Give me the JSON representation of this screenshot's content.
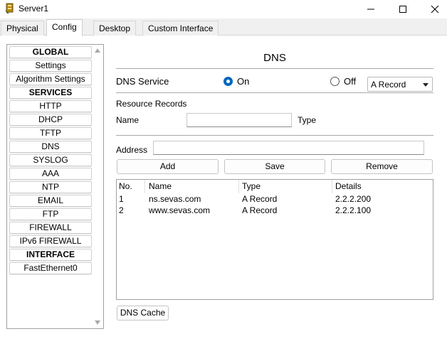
{
  "window": {
    "title": "Server1",
    "icons": [
      "app-icon",
      "minimize-icon",
      "maximize-icon",
      "close-icon"
    ]
  },
  "tabs": [
    {
      "label": "Physical"
    },
    {
      "label": "Config"
    },
    {
      "label": "Desktop"
    },
    {
      "label": "Custom Interface"
    }
  ],
  "active_tab": "Config",
  "sidebar": {
    "items": [
      {
        "label": "GLOBAL",
        "kind": "header"
      },
      {
        "label": "Settings",
        "kind": "item"
      },
      {
        "label": "Algorithm Settings",
        "kind": "item"
      },
      {
        "label": "SERVICES",
        "kind": "header"
      },
      {
        "label": "HTTP",
        "kind": "item"
      },
      {
        "label": "DHCP",
        "kind": "item"
      },
      {
        "label": "TFTP",
        "kind": "item"
      },
      {
        "label": "DNS",
        "kind": "item"
      },
      {
        "label": "SYSLOG",
        "kind": "item"
      },
      {
        "label": "AAA",
        "kind": "item"
      },
      {
        "label": "NTP",
        "kind": "item"
      },
      {
        "label": "EMAIL",
        "kind": "item"
      },
      {
        "label": "FTP",
        "kind": "item"
      },
      {
        "label": "FIREWALL",
        "kind": "item"
      },
      {
        "label": "IPv6 FIREWALL",
        "kind": "item"
      },
      {
        "label": "INTERFACE",
        "kind": "header"
      },
      {
        "label": "FastEthernet0",
        "kind": "item"
      }
    ]
  },
  "dns": {
    "title": "DNS",
    "service_label": "DNS Service",
    "on_label": "On",
    "off_label": "Off",
    "service_state": "On",
    "resource_records_label": "Resource Records",
    "name_label": "Name",
    "name_value": "",
    "type_label": "Type",
    "type_value": "A Record",
    "address_label": "Address",
    "address_value": "",
    "buttons": {
      "add": "Add",
      "save": "Save",
      "remove": "Remove",
      "cache": "DNS Cache"
    },
    "table": {
      "headers": [
        "No.",
        "Name",
        "Type",
        "Details"
      ],
      "rows": [
        {
          "no": "1",
          "name": "ns.sevas.com",
          "type": "A Record",
          "details": "2.2.2.200"
        },
        {
          "no": "2",
          "name": "www.sevas.com",
          "type": "A Record",
          "details": "2.2.2.100"
        }
      ]
    }
  },
  "colors": {
    "accent": "#0067c0",
    "border": "#a0a0a0",
    "background": "#f0f0f0"
  }
}
